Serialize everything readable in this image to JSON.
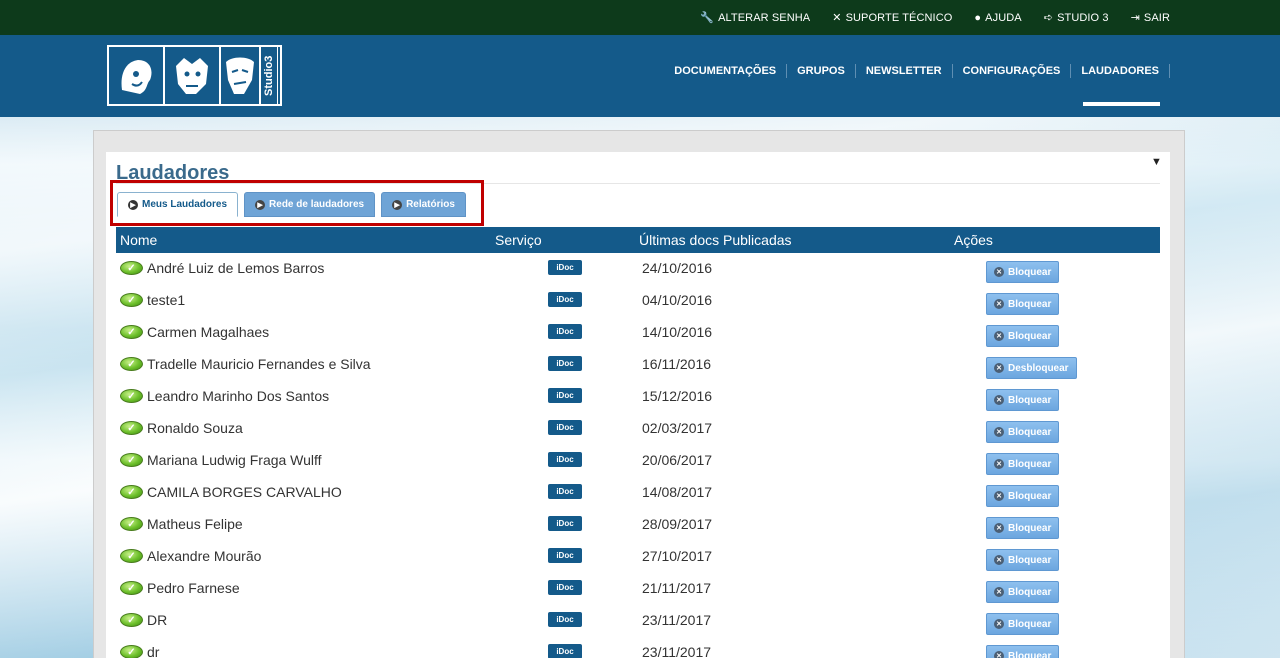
{
  "topbar": {
    "items": [
      {
        "icon": "wrench-icon",
        "glyph": "🔧",
        "label": "ALTERAR SENHA"
      },
      {
        "icon": "tools-icon",
        "glyph": "✕",
        "label": "SUPORTE TÉCNICO"
      },
      {
        "icon": "help-icon",
        "glyph": "●",
        "label": "AJUDA"
      },
      {
        "icon": "arrow-right-icon",
        "glyph": "➪",
        "label": "STUDIO 3"
      },
      {
        "icon": "logout-icon",
        "glyph": "⇥",
        "label": "SAIR"
      }
    ]
  },
  "logo": {
    "text": "Studio3"
  },
  "nav": {
    "items": [
      "DOCUMENTAÇÕES",
      "GRUPOS",
      "NEWSLETTER",
      "CONFIGURAÇÕES",
      "LAUDADORES"
    ],
    "active": "LAUDADORES"
  },
  "page": {
    "title": "Laudadores"
  },
  "tabs": [
    {
      "label": "Meus Laudadores",
      "active": true
    },
    {
      "label": "Rede de laudadores",
      "active": false
    },
    {
      "label": "Relatórios",
      "active": false
    }
  ],
  "table": {
    "columns": [
      "Nome",
      "Serviço",
      "Últimas docs Publicadas",
      "Ações"
    ],
    "rows": [
      {
        "name": "André Luiz de Lemos Barros",
        "service": "iDoc",
        "date": "24/10/2016",
        "action": "Bloquear"
      },
      {
        "name": "teste1",
        "service": "iDoc",
        "date": "04/10/2016",
        "action": "Bloquear"
      },
      {
        "name": "Carmen Magalhaes",
        "service": "iDoc",
        "date": "14/10/2016",
        "action": "Bloquear"
      },
      {
        "name": "Tradelle Mauricio Fernandes e Silva",
        "service": "iDoc",
        "date": "16/11/2016",
        "action": "Desbloquear"
      },
      {
        "name": "Leandro Marinho Dos Santos",
        "service": "iDoc",
        "date": "15/12/2016",
        "action": "Bloquear"
      },
      {
        "name": "Ronaldo Souza",
        "service": "iDoc",
        "date": "02/03/2017",
        "action": "Bloquear"
      },
      {
        "name": "Mariana Ludwig Fraga Wulff",
        "service": "iDoc",
        "date": "20/06/2017",
        "action": "Bloquear"
      },
      {
        "name": "CAMILA BORGES CARVALHO",
        "service": "iDoc",
        "date": "14/08/2017",
        "action": "Bloquear"
      },
      {
        "name": "Matheus Felipe",
        "service": "iDoc",
        "date": "28/09/2017",
        "action": "Bloquear"
      },
      {
        "name": "Alexandre Mourão",
        "service": "iDoc",
        "date": "27/10/2017",
        "action": "Bloquear"
      },
      {
        "name": "Pedro Farnese",
        "service": "iDoc",
        "date": "21/11/2017",
        "action": "Bloquear"
      },
      {
        "name": "DR",
        "service": "iDoc",
        "date": "23/11/2017",
        "action": "Bloquear"
      },
      {
        "name": "dr",
        "service": "iDoc",
        "date": "23/11/2017",
        "action": "Bloquear"
      }
    ]
  },
  "colors": {
    "topbar": "#0d3a1b",
    "header": "#145a8a",
    "accent": "#6fa4d6",
    "highlight": "#c00000"
  }
}
